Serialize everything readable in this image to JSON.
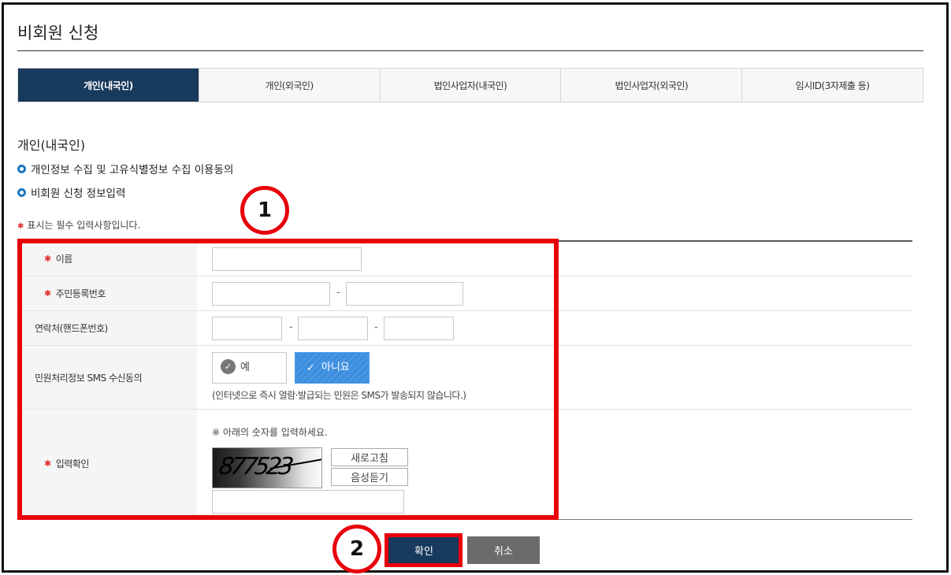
{
  "page": {
    "title": "비회원 신청"
  },
  "tabs": [
    {
      "label": "개인(내국인)",
      "active": true
    },
    {
      "label": "개인(외국인)",
      "active": false
    },
    {
      "label": "법인사업자(내국인)",
      "active": false
    },
    {
      "label": "법인사업자(외국인)",
      "active": false
    },
    {
      "label": "임시ID(3자제출 등)",
      "active": false
    }
  ],
  "section": {
    "title": "개인(내국인)",
    "bullets": [
      "개인정보 수집 및 고유식별정보 수집 이용동의",
      "비회원 신청 정보입력"
    ],
    "required_note": "표시는 필수 입력사항입니다.",
    "required_mark": "✱"
  },
  "form": {
    "name": {
      "label": "이름",
      "value": ""
    },
    "rrn": {
      "label": "주민등록번호",
      "value1": "",
      "value2": "",
      "separator": "-"
    },
    "phone": {
      "label": "연락처(핸드폰번호)",
      "values": [
        "",
        "",
        ""
      ],
      "separator": "-"
    },
    "sms": {
      "label": "민원처리정보 SMS 수신동의",
      "yes_label": "예",
      "no_label": "아니요",
      "selected": "아니요",
      "note": "(인터넷으로 즉시 열람·발급되는 민원은 SMS가 발송되지 않습니다.)"
    },
    "captcha": {
      "label": "입력확인",
      "note": "※ 아래의 숫자를 입력하세요.",
      "image_text": "877523",
      "refresh_label": "새로고침",
      "audio_label": "음성듣기",
      "value": ""
    }
  },
  "buttons": {
    "ok": "확인",
    "cancel": "취소"
  },
  "annotations": {
    "marker1": "1",
    "marker2": "2",
    "color": "#e8000b"
  },
  "colors": {
    "primary": "#183a5c",
    "accent": "#1b78c2",
    "required": "#e03030",
    "sms_selected": "#3a8de0"
  }
}
